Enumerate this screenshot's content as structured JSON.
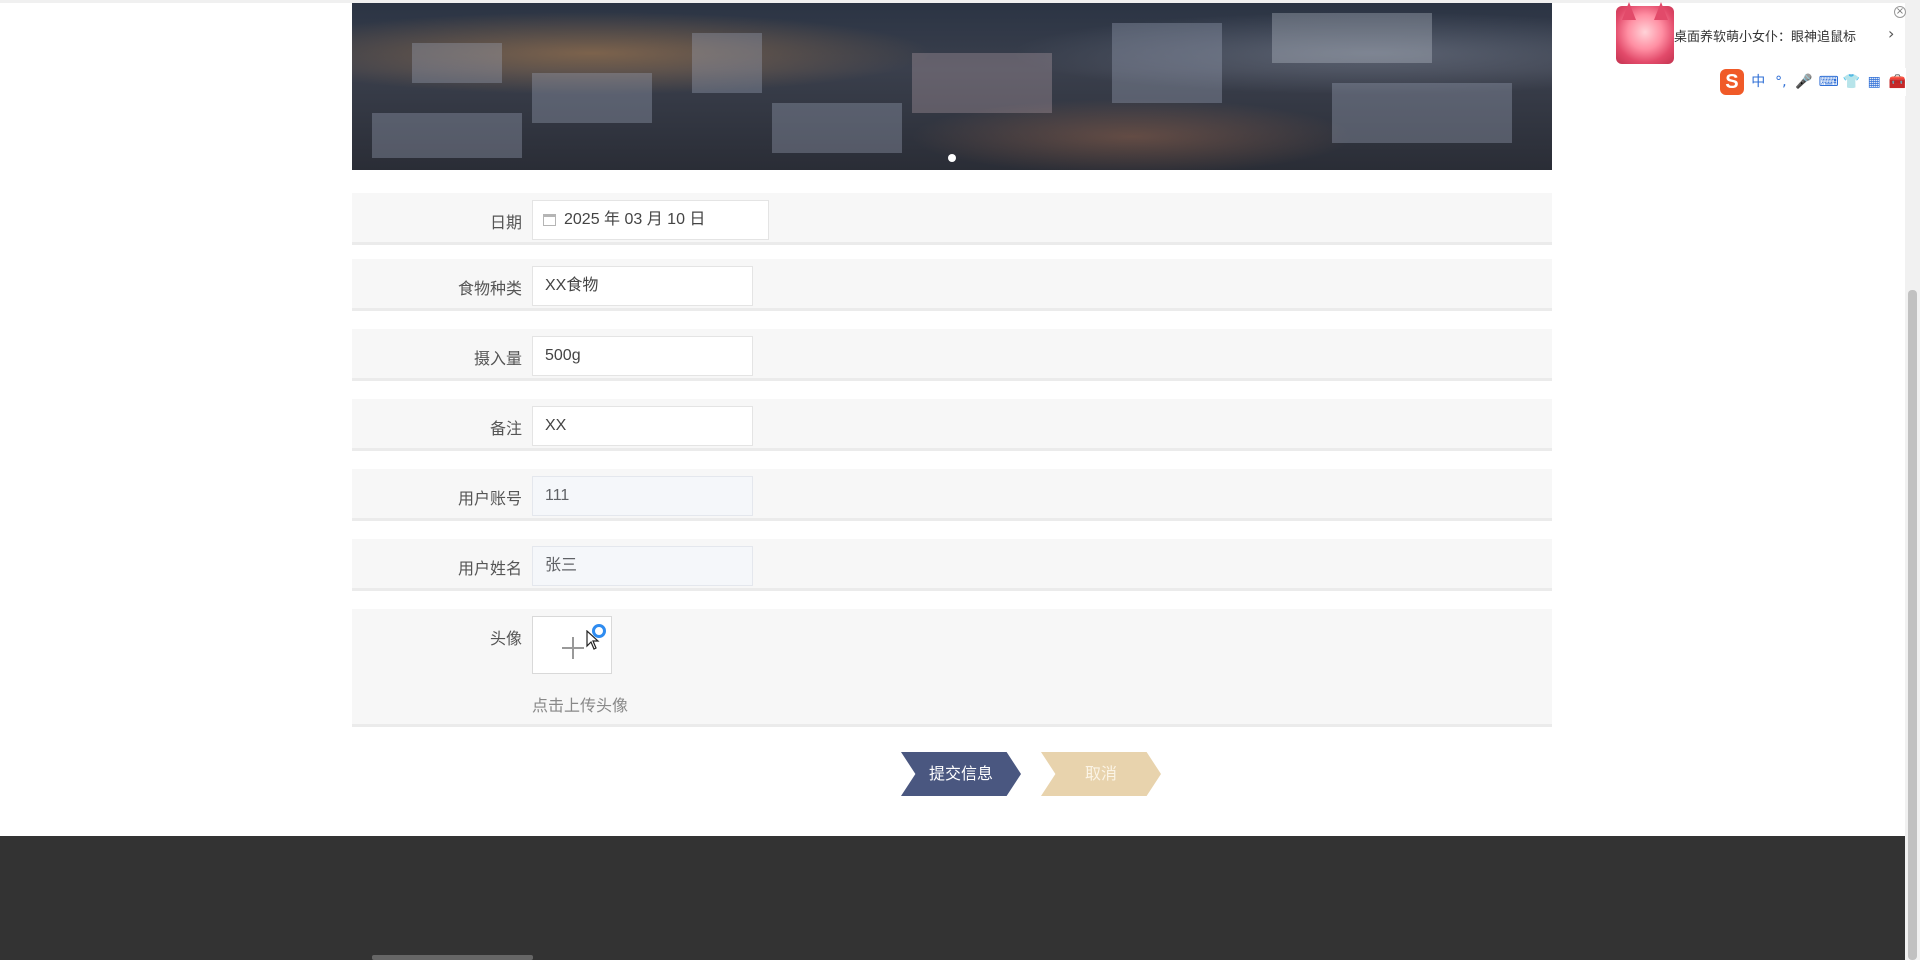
{
  "banner": {
    "slide_count": 1,
    "active_slide": 0
  },
  "form": {
    "date": {
      "label": "日期",
      "value": "2025 年 03 月 10 日"
    },
    "food_type": {
      "label": "食物种类",
      "value": "XX食物"
    },
    "intake": {
      "label": "摄入量",
      "value": "500g"
    },
    "remark": {
      "label": "备注",
      "value": "XX"
    },
    "user_account": {
      "label": "用户账号",
      "value": "111"
    },
    "user_name": {
      "label": "用户姓名",
      "value": "张三"
    },
    "avatar": {
      "label": "头像",
      "tip": "点击上传头像",
      "icon": "plus-icon"
    }
  },
  "actions": {
    "submit_label": "提交信息",
    "cancel_label": "取消"
  },
  "colors": {
    "submit": "#4a5780",
    "cancel": "#e8d3ad",
    "footer": "#333333",
    "row_bg": "#f7f7f7"
  },
  "widget": {
    "text": "桌面养软萌小女仆：眼神追鼠标",
    "chevron": "›",
    "close": "×",
    "ime_logo": "S",
    "ime_icons": [
      "中",
      "°,",
      "🎤",
      "⌨",
      "👕",
      "▦",
      "🧰"
    ]
  }
}
